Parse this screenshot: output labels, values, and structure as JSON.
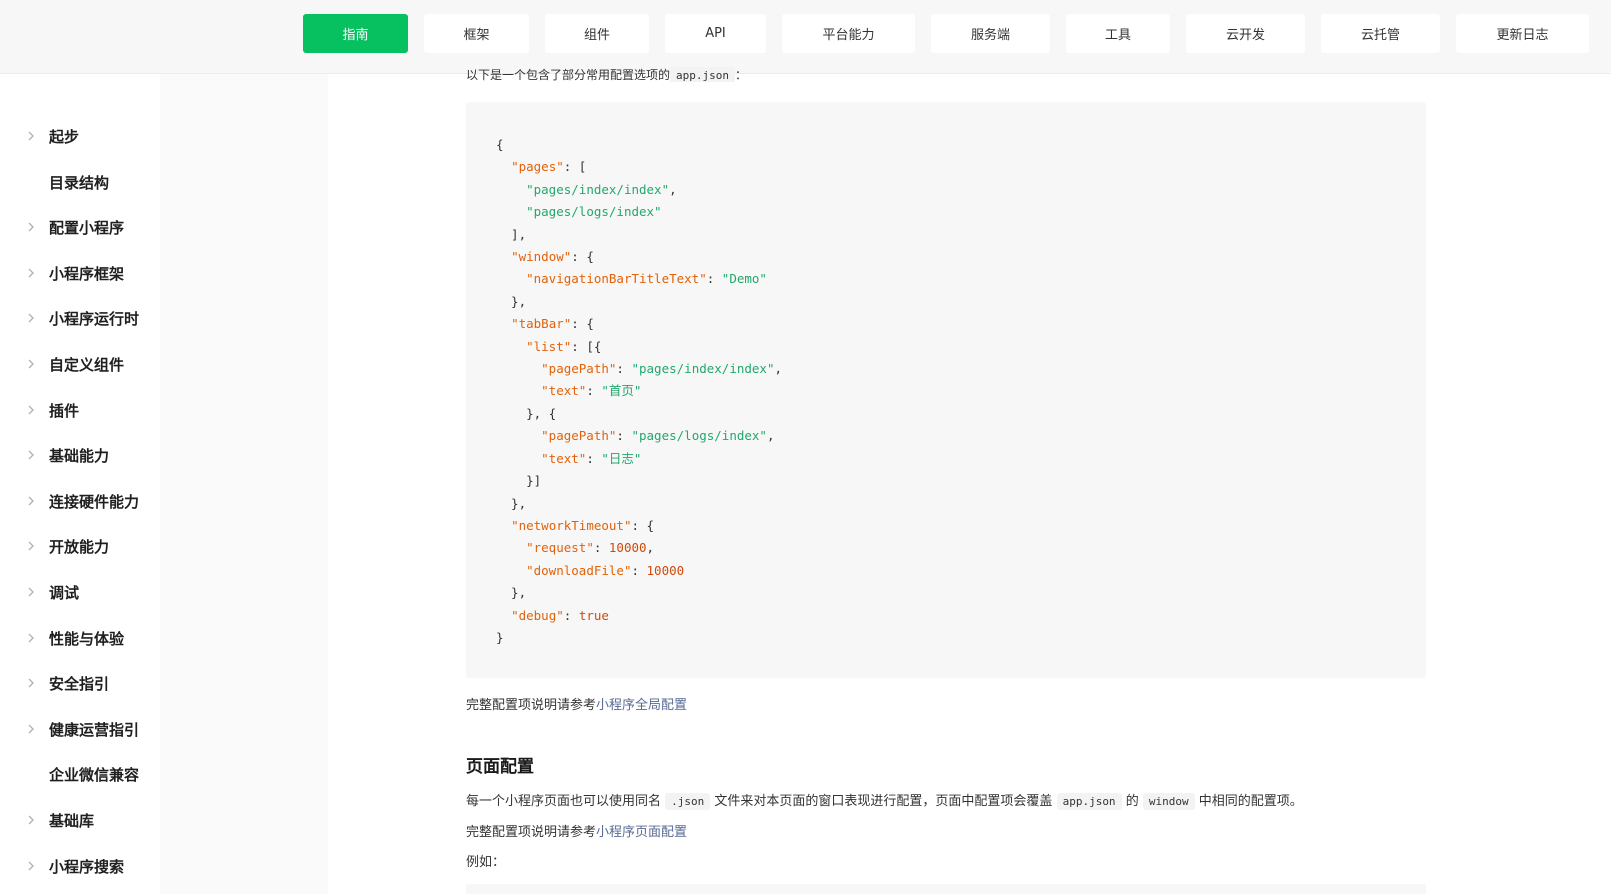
{
  "topnav": {
    "tabs": [
      {
        "label": "指南",
        "active": true
      },
      {
        "label": "框架"
      },
      {
        "label": "组件"
      },
      {
        "label": "API"
      },
      {
        "label": "平台能力"
      },
      {
        "label": "服务端"
      },
      {
        "label": "工具"
      },
      {
        "label": "云开发"
      },
      {
        "label": "云托管"
      },
      {
        "label": "更新日志"
      }
    ]
  },
  "sidebar": {
    "items": [
      {
        "label": "起步",
        "expandable": true
      },
      {
        "label": "目录结构",
        "expandable": false
      },
      {
        "label": "配置小程序",
        "expandable": true
      },
      {
        "label": "小程序框架",
        "expandable": true
      },
      {
        "label": "小程序运行时",
        "expandable": true
      },
      {
        "label": "自定义组件",
        "expandable": true
      },
      {
        "label": "插件",
        "expandable": true
      },
      {
        "label": "基础能力",
        "expandable": true
      },
      {
        "label": "连接硬件能力",
        "expandable": true
      },
      {
        "label": "开放能力",
        "expandable": true
      },
      {
        "label": "调试",
        "expandable": true
      },
      {
        "label": "性能与体验",
        "expandable": true
      },
      {
        "label": "安全指引",
        "expandable": true
      },
      {
        "label": "健康运营指引",
        "expandable": true
      },
      {
        "label": "企业微信兼容",
        "expandable": false
      },
      {
        "label": "基础库",
        "expandable": true
      },
      {
        "label": "小程序搜索",
        "expandable": true
      }
    ]
  },
  "content": {
    "intro_prefix": "以下是一个包含了部分常用配置选项的",
    "intro_code": "app.json",
    "intro_suffix": "：",
    "code_lines": [
      "{",
      "  \"pages\": [",
      "    \"pages/index/index\",",
      "    \"pages/logs/index\"",
      "  ],",
      "  \"window\": {",
      "    \"navigationBarTitleText\": \"Demo\"",
      "  },",
      "  \"tabBar\": {",
      "    \"list\": [{",
      "      \"pagePath\": \"pages/index/index\",",
      "      \"text\": \"首页\"",
      "    }, {",
      "      \"pagePath\": \"pages/logs/index\",",
      "      \"text\": \"日志\"",
      "    }]",
      "  },",
      "  \"networkTimeout\": {",
      "    \"request\": 10000,",
      "    \"downloadFile\": 10000",
      "  },",
      "  \"debug\": true",
      "}"
    ],
    "full_config_prefix": "完整配置项说明请参考",
    "full_config_link": "小程序全局配置",
    "section_title": "页面配置",
    "page_desc_1": "每一个小程序页面也可以使用同名",
    "page_desc_code1": ".json",
    "page_desc_2": "文件来对本页面的窗口表现进行配置，页面中配置项会覆盖",
    "page_desc_code2": "app.json",
    "page_desc_3": "的",
    "page_desc_code3": "window",
    "page_desc_4": "中相同的配置项。",
    "page_config_prefix": "完整配置项说明请参考",
    "page_config_link": "小程序页面配置",
    "example_label": "例如："
  },
  "colors": {
    "accent": "#07c160",
    "link": "#576b95",
    "json_key": "#e36209",
    "json_string": "#22a86b",
    "json_number": "#d14a0a"
  }
}
